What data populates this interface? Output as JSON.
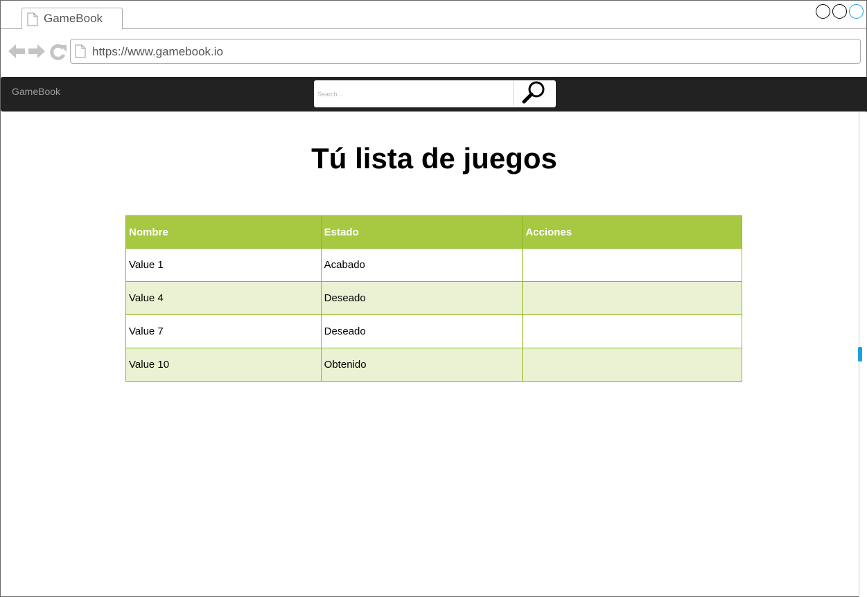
{
  "browser": {
    "tab_title": "GameBook",
    "url": "https://www.gamebook.io",
    "accent_color": "#1ba1e2"
  },
  "header": {
    "brand": "GameBook",
    "search_placeholder": "Search...",
    "background_color": "#222222"
  },
  "main": {
    "title": "Tú lista de juegos",
    "table": {
      "header_color": "#a7c942",
      "alt_row_color": "#eaf2d3",
      "columns": [
        "Nombre",
        "Estado",
        "Acciones"
      ],
      "rows": [
        {
          "nombre": "Value 1",
          "estado": "Acabado",
          "acciones": ""
        },
        {
          "nombre": "Value 4",
          "estado": "Deseado",
          "acciones": ""
        },
        {
          "nombre": "Value 7",
          "estado": "Deseado",
          "acciones": ""
        },
        {
          "nombre": "Value 10",
          "estado": "Obtenido",
          "acciones": ""
        }
      ]
    }
  }
}
